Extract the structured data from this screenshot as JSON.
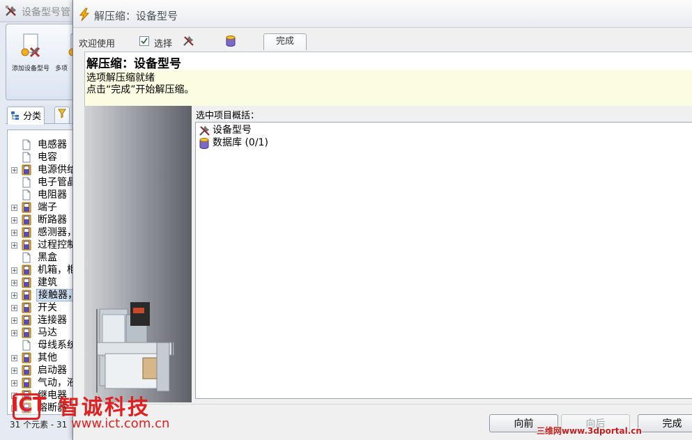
{
  "background_window": {
    "title": "设备型号管",
    "ribbon": {
      "add_button_label": "添加设备型号",
      "multi_button_label": "多项"
    },
    "tabs": {
      "category_label": "分类",
      "filter_label": "‌"
    },
    "tree_items": [
      {
        "label": "电感器",
        "expandable": false,
        "icon": "page-icon"
      },
      {
        "label": "电容",
        "expandable": false,
        "icon": "page-icon"
      },
      {
        "label": "电源供给",
        "expandable": true,
        "icon": "book-icon"
      },
      {
        "label": "电子管晶",
        "expandable": false,
        "icon": "page-icon"
      },
      {
        "label": "电阻器",
        "expandable": false,
        "icon": "page-icon"
      },
      {
        "label": "端子",
        "expandable": true,
        "icon": "book-icon"
      },
      {
        "label": "断路器",
        "expandable": true,
        "icon": "book-icon"
      },
      {
        "label": "感测器，",
        "expandable": true,
        "icon": "book-icon"
      },
      {
        "label": "过程控制",
        "expandable": true,
        "icon": "book-icon"
      },
      {
        "label": "黑盒",
        "expandable": false,
        "icon": "page-icon"
      },
      {
        "label": "机箱，柜",
        "expandable": true,
        "icon": "book-icon"
      },
      {
        "label": "建筑",
        "expandable": true,
        "icon": "book-icon"
      },
      {
        "label": "接触器，",
        "expandable": true,
        "icon": "book-icon",
        "selected": true
      },
      {
        "label": "开关",
        "expandable": true,
        "icon": "book-icon"
      },
      {
        "label": "连接器",
        "expandable": true,
        "icon": "book-icon"
      },
      {
        "label": "马达",
        "expandable": true,
        "icon": "book-icon"
      },
      {
        "label": "母线系统",
        "expandable": false,
        "icon": "page-icon"
      },
      {
        "label": "其他",
        "expandable": true,
        "icon": "book-icon"
      },
      {
        "label": "启动器",
        "expandable": true,
        "icon": "book-icon"
      },
      {
        "label": "气动，液",
        "expandable": true,
        "icon": "book-icon"
      },
      {
        "label": "继电器",
        "expandable": true,
        "icon": "book-icon"
      },
      {
        "label": "熔断器",
        "expandable": true,
        "icon": "book-icon"
      }
    ],
    "status_text": "31 个元素 - 31"
  },
  "dialog": {
    "title": "解压缩：设备型号",
    "wizard_steps": {
      "welcome": "欢迎使用",
      "select": "选择",
      "finish_tab": "完成"
    },
    "header_title": "解压缩：设备型号",
    "info_line1": "选项解压缩就绪",
    "info_line2": "点击“完成”开始解压缩。",
    "summary_label": "选中项目概括：",
    "summary_items": [
      {
        "label": "设备型号",
        "icon": "tools-icon"
      },
      {
        "label": "数据库 (0/1)",
        "icon": "database-icon"
      }
    ],
    "buttons": {
      "back": "向前",
      "next": "向后",
      "finish": "完成"
    }
  },
  "watermarks": {
    "ict_logo": "ICT",
    "ict_name": "智诚科技",
    "ict_url": "www.ict.com.cn",
    "portal": "三维网www.3dportal.cn"
  },
  "colors": {
    "info_band": "#fcfce2",
    "watermark_red": "#e02020",
    "selection": "#cfe0f5"
  }
}
